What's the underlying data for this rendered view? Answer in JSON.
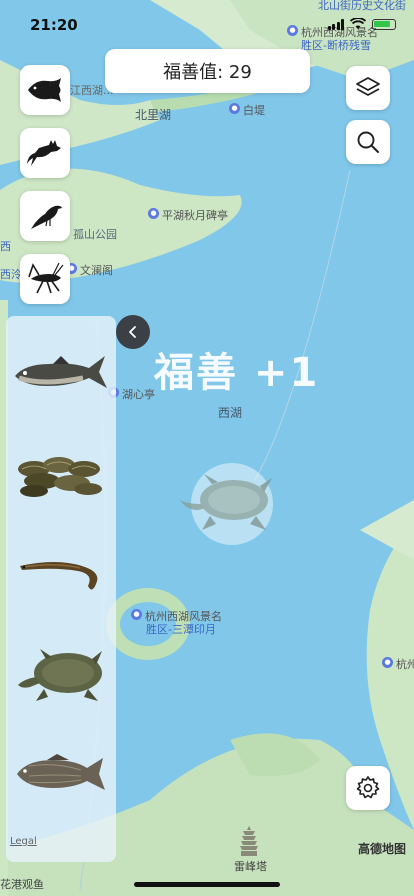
{
  "status_bar": {
    "time": "21:20"
  },
  "score": {
    "text": "福善值: 29"
  },
  "toast": {
    "text": "福善 +1"
  },
  "map": {
    "labels": {
      "north_top": "北山街历史文化街",
      "scenic_1": "杭州西湖风景名",
      "scenic_2": "胜区-断桥残雪",
      "bei_li_hu": "北里湖",
      "bai_di": "白堤",
      "xihu_left": "江西湖...",
      "ping_hu": "平湖秋月碑亭",
      "gu_shan": "孤山公园",
      "wen_lan": "文澜阁",
      "hu_xin": "湖心亭",
      "xi_hu": "西湖",
      "san_tan_1": "杭州西湖风景名",
      "san_tan_2": "胜区-三潭印月",
      "hang_zhou_right": "杭州",
      "lei_feng": "雷峰塔",
      "left_edge_1": "西",
      "left_edge_2": "西泠",
      "bottom_left": "花港观鱼",
      "legal": "Legal",
      "amap": "高德地图"
    }
  },
  "category_buttons": [
    {
      "name": "fish",
      "icon": "fish-icon"
    },
    {
      "name": "mammal",
      "icon": "fox-icon"
    },
    {
      "name": "bird",
      "icon": "bird-icon"
    },
    {
      "name": "insect",
      "icon": "grasshopper-icon"
    }
  ],
  "species": [
    {
      "name": "silver-carp",
      "icon": "carp-icon"
    },
    {
      "name": "clams",
      "icon": "clam-icon"
    },
    {
      "name": "eel",
      "icon": "eel-icon"
    },
    {
      "name": "soft-shell-turtle",
      "icon": "turtle-icon"
    },
    {
      "name": "carp",
      "icon": "crucian-carp-icon"
    }
  ],
  "colors": {
    "water": "#7fc6ea",
    "land": "#cfe8c9",
    "accent_green": "#32c548",
    "poi_blue": "#5b79e0"
  }
}
